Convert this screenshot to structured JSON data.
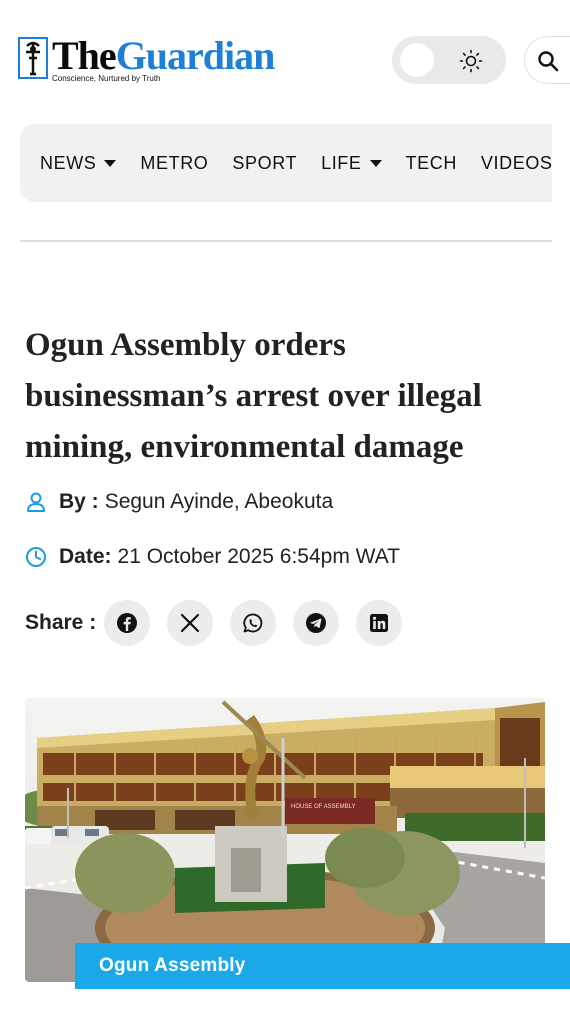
{
  "header": {
    "logo": {
      "the": "The",
      "guardian": "Guardian",
      "tagline": "Conscience, Nurtured by Truth"
    },
    "theme_toggle_icon": "sun-icon",
    "search_icon": "search-icon"
  },
  "nav": {
    "items": [
      {
        "label": "NEWS",
        "has_dropdown": true
      },
      {
        "label": "METRO",
        "has_dropdown": false
      },
      {
        "label": "SPORT",
        "has_dropdown": false
      },
      {
        "label": "LIFE",
        "has_dropdown": true
      },
      {
        "label": "TECH",
        "has_dropdown": false
      },
      {
        "label": "VIDEOS",
        "has_dropdown": false
      }
    ]
  },
  "article": {
    "title": "Ogun Assembly orders businessman’s arrest over illegal mining, environmental damage",
    "byline_label": "By :",
    "author": "Segun Ayinde, Abeokuta",
    "date_label": "Date:",
    "date": "21 October 2025 6:54pm WAT",
    "share_label": "Share :",
    "share_icons": [
      "facebook-icon",
      "x-icon",
      "whatsapp-icon",
      "telegram-icon",
      "linkedin-icon"
    ],
    "image": {
      "building_sign": "HOUSE OF ASSEMBLY",
      "tag": "Ogun Assembly"
    }
  },
  "colors": {
    "brand_blue": "#1e7fd8",
    "tag_blue": "#1ca7e9",
    "link_blue": "#1e9be0"
  }
}
